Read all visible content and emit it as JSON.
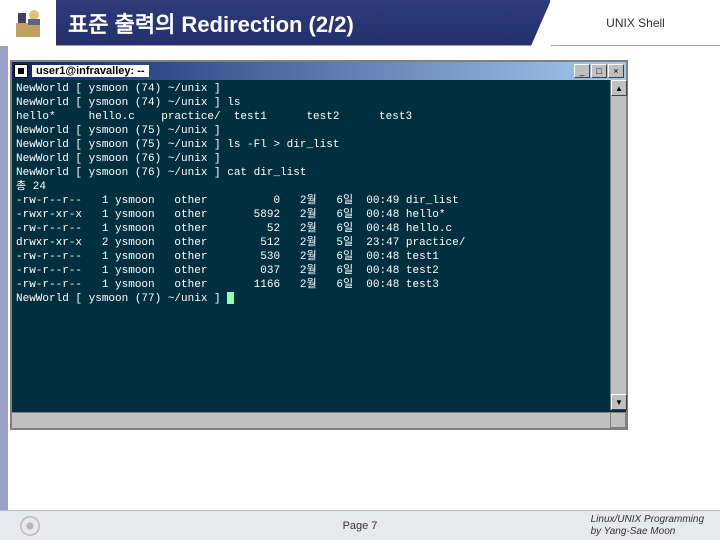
{
  "header": {
    "title": "표준 출력의 Redirection (2/2)",
    "corner": "UNIX Shell"
  },
  "terminal": {
    "title": "user1@infravalley: --",
    "btn_min": "_",
    "btn_max": "□",
    "btn_close": "×",
    "arrow_up": "▲",
    "arrow_down": "▼",
    "lines": [
      "NewWorld [ ysmoon (74) ~/unix ]",
      "NewWorld [ ysmoon (74) ~/unix ] ls",
      "hello*     hello.c    practice/  test1      test2      test3",
      "NewWorld [ ysmoon (75) ~/unix ]",
      "NewWorld [ ysmoon (75) ~/unix ] ls -Fl > dir_list",
      "NewWorld [ ysmoon (76) ~/unix ]",
      "NewWorld [ ysmoon (76) ~/unix ] cat dir_list",
      "총 24",
      "-rw-r--r--   1 ysmoon   other          0   2월   6일  00:49 dir_list",
      "-rwxr-xr-x   1 ysmoon   other       5892   2월   6일  00:48 hello*",
      "-rw-r--r--   1 ysmoon   other         52   2월   6일  00:48 hello.c",
      "drwxr-xr-x   2 ysmoon   other        512   2월   5일  23:47 practice/",
      "-rw-r--r--   1 ysmoon   other        530   2월   6일  00:48 test1",
      "-rw-r--r--   1 ysmoon   other        037   2월   6일  00:48 test2",
      "-rw-r--r--   1 ysmoon   other       1166   2월   6일  00:48 test3",
      "NewWorld [ ysmoon (77) ~/unix ] "
    ]
  },
  "footer": {
    "page": "Page 7",
    "credit1": "Linux/UNIX Programming",
    "credit2": "by Yang-Sae Moon"
  }
}
